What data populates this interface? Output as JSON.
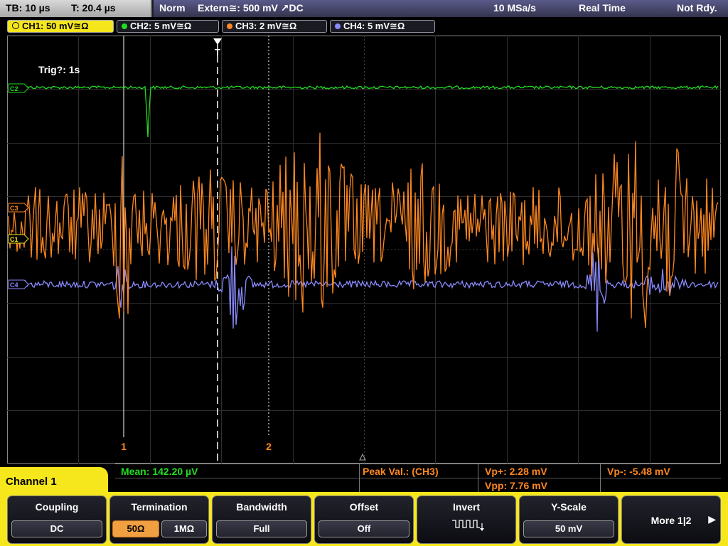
{
  "status": {
    "timebase": "TB: 10 µs",
    "trigger_time": "T: 20.4 µs",
    "mode": "Norm",
    "trigger_source": "Extern≅: 500 mV ↗DC",
    "sample_rate": "10 MSa/s",
    "acquisition": "Real Time",
    "state": "Not Rdy."
  },
  "channels": [
    {
      "label": "CH1: 50 mV≅Ω",
      "color": "#f6e61c"
    },
    {
      "label": "CH2: 5 mV≅Ω",
      "color": "#22dd22"
    },
    {
      "label": "CH3: 2 mV≅Ω",
      "color": "#ff8820"
    },
    {
      "label": "CH4: 5 mV≅Ω",
      "color": "#8a8aff"
    }
  ],
  "waveform": {
    "trigger_info": "Trig?: 1s",
    "trigger_marker": "T",
    "cursor1_label": "1",
    "cursor2_label": "2",
    "ch_markers": [
      "C2",
      "C3",
      "C1",
      "C4"
    ]
  },
  "measurements": {
    "mean": "Mean: 142.20 µV",
    "peak_label": "Peak Val.: (CH3)",
    "vp_plus": "Vp+: 2.28 mV",
    "vp_minus": "Vp-: -5.48 mV",
    "vpp": "Vpp: 7.76 mV"
  },
  "menu": {
    "channel_title": "Channel 1",
    "coupling": {
      "title": "Coupling",
      "value": "DC"
    },
    "termination": {
      "title": "Termination",
      "opt1": "50Ω",
      "opt2": "1MΩ"
    },
    "bandwidth": {
      "title": "Bandwidth",
      "value": "Full"
    },
    "offset": {
      "title": "Offset",
      "value": "Off"
    },
    "invert": {
      "title": "Invert",
      "icon": "pulse-icon"
    },
    "yscale": {
      "title": "Y-Scale",
      "value": "50 mV"
    },
    "more": {
      "title": "More 1|2",
      "icon": "arrow-right-icon"
    }
  }
}
